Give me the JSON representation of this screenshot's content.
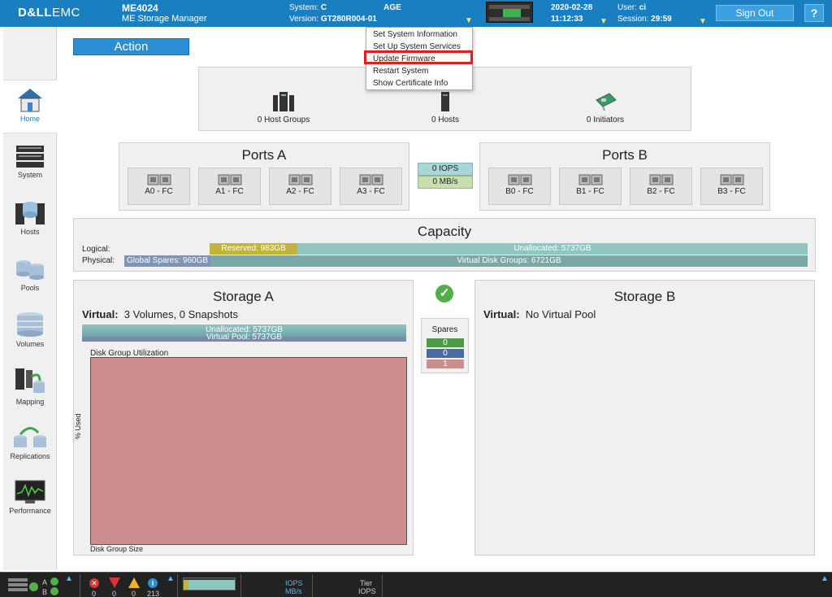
{
  "header": {
    "brand": {
      "dell": "D&LL",
      "emc": "EMC"
    },
    "product": {
      "model": "ME4024",
      "name": "ME Storage Manager"
    },
    "system": {
      "system_label": "System:",
      "system_value": "C",
      "system_value2": "AGE",
      "version_label": "Version:",
      "version_value": "GT280R004-01"
    },
    "date": "2020-02-28",
    "time": "11:12:33",
    "user": {
      "user_label": "User:",
      "user_value": "ci",
      "session_label": "Session:",
      "session_value": "29:59"
    },
    "signout_label": "Sign Out",
    "help_label": "?"
  },
  "sidebar": {
    "items": [
      {
        "label": "Home",
        "icon": "home-icon"
      },
      {
        "label": "System",
        "icon": "system-icon"
      },
      {
        "label": "Hosts",
        "icon": "hosts-icon"
      },
      {
        "label": "Pools",
        "icon": "pools-icon"
      },
      {
        "label": "Volumes",
        "icon": "volumes-icon"
      },
      {
        "label": "Mapping",
        "icon": "mapping-icon"
      },
      {
        "label": "Replications",
        "icon": "replications-icon"
      },
      {
        "label": "Performance",
        "icon": "performance-icon"
      }
    ]
  },
  "action_label": "Action",
  "dropdown": {
    "items": [
      "Set System Information",
      "Set Up System Services",
      "Update Firmware",
      "Restart System",
      "Show Certificate Info"
    ]
  },
  "hosts": {
    "host_groups": "0 Host Groups",
    "hosts": "0 Hosts",
    "initiators": "0 Initiators"
  },
  "ports_a": {
    "title": "Ports A",
    "ports": [
      "A0 - FC",
      "A1 - FC",
      "A2 - FC",
      "A3 - FC"
    ]
  },
  "ports_b": {
    "title": "Ports B",
    "ports": [
      "B0 - FC",
      "B1 - FC",
      "B2 - FC",
      "B3 - FC"
    ]
  },
  "io": {
    "iops": "0 IOPS",
    "mbs": "0 MB/s"
  },
  "capacity": {
    "title": "Capacity",
    "logical_label": "Logical:",
    "physical_label": "Physical:",
    "reserved": "Reserved: 983GB",
    "unallocated": "Unallocated: 5737GB",
    "global_spares": "Global Spares: 960GB",
    "virtual_disk_groups": "Virtual Disk Groups: 6721GB"
  },
  "storage_a": {
    "title": "Storage A",
    "virtual_label": "Virtual:",
    "virtual_value": "3 Volumes, 0 Snapshots",
    "pool_unallocated": "Unallocated: 5737GB",
    "pool_virtual": "Virtual Pool: 5737GB",
    "chart_title": "Disk Group Utilization",
    "y_label": "% Used",
    "x_label": "Disk Group Size"
  },
  "storage_b": {
    "title": "Storage B",
    "virtual_label": "Virtual:",
    "virtual_value": "No Virtual Pool"
  },
  "spares": {
    "title": "Spares",
    "values": [
      "0",
      "0",
      "1"
    ],
    "colors": [
      "#4f9a4a",
      "#4a6aa3",
      "#cd8d8e"
    ]
  },
  "footer": {
    "controller_a": "A",
    "controller_b": "B",
    "errors": "0",
    "critical": "0",
    "warnings": "0",
    "info": "213",
    "iops_label": "IOPS",
    "mbs_label": "MB/s",
    "tier_label": "Tier",
    "tier_iops_label": "IOPS"
  },
  "colors": {
    "header": "#1a7fc1",
    "reserved": "#c2b43a",
    "unallocated": "#8fc7c0",
    "global_spares": "#7e94b5",
    "virtual_disk_groups": "#78a9a6",
    "disk_group": "#cd8d8e"
  }
}
